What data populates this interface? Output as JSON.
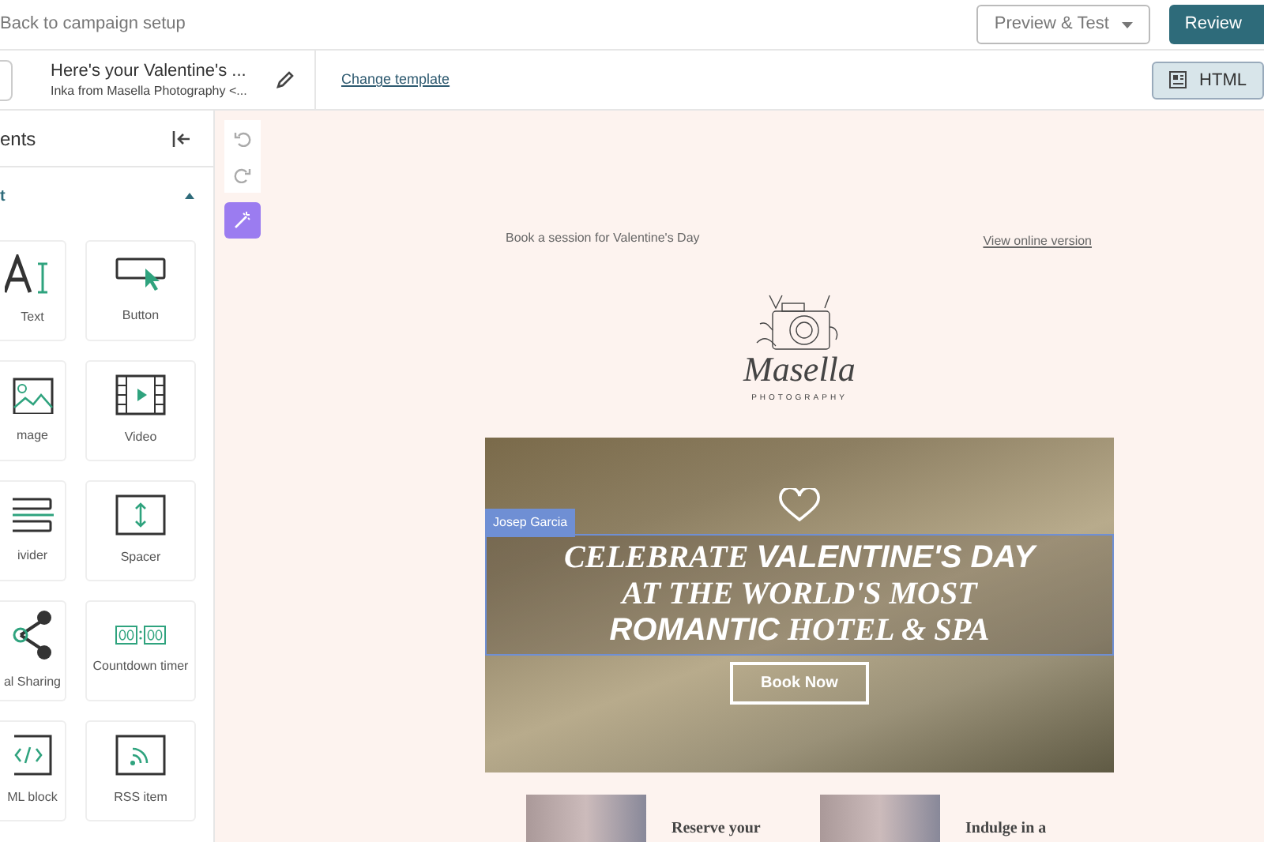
{
  "top_bar": {
    "back_link": "Back to campaign setup",
    "buttons": [
      {
        "label": "Preview & Test",
        "kind": "dropdown"
      },
      {
        "label": "Review",
        "kind": "primary"
      }
    ]
  },
  "editor_bar": {
    "subject": "Here's your Valentine's ...",
    "sender": "Inka from Masella Photography <...",
    "change_template": "Change template",
    "view_toggle": {
      "label": "HTML",
      "selected": true
    }
  },
  "sidebar": {
    "title": "ents",
    "section": {
      "label": "t",
      "expanded": true
    },
    "blocks": [
      {
        "label": "Text",
        "kind": "text"
      },
      {
        "label": "Button",
        "kind": "button"
      },
      {
        "label": "mage",
        "kind": "image"
      },
      {
        "label": "Video",
        "kind": "video"
      },
      {
        "label": "ivider",
        "kind": "divider"
      },
      {
        "label": "Spacer",
        "kind": "spacer"
      },
      {
        "label": "al Sharing",
        "kind": "social"
      },
      {
        "label": "Countdown timer",
        "kind": "countdown"
      },
      {
        "label": "ML block",
        "kind": "html"
      },
      {
        "label": "RSS item",
        "kind": "rss"
      }
    ]
  },
  "toolbar": [
    {
      "kind": "undo",
      "disabled": true
    },
    {
      "kind": "redo",
      "disabled": true
    },
    {
      "kind": "magic",
      "disabled": false
    }
  ],
  "email": {
    "preheader": "Book a session for Valentine's Day",
    "online_link": "View online version",
    "logo": {
      "name": "Masella",
      "tagline": "PHOTOGRAPHY"
    },
    "hero": {
      "editor_tag": "Josep Garcia",
      "headline_lines": [
        "CELEBRATE **VALENTINE'S DAY**",
        "AT THE WORLD'S MOST",
        "**ROMANTIC**  HOTEL & SPA"
      ],
      "button": "Book Now"
    },
    "features": [
      {
        "title": "Reserve your"
      },
      {
        "title": "Indulge in a"
      }
    ]
  }
}
